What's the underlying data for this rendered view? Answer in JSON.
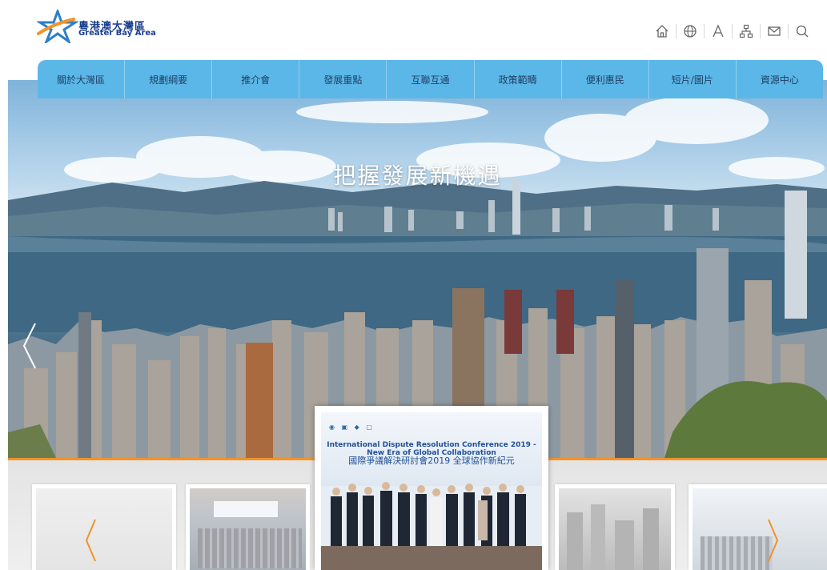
{
  "logo": {
    "name_cn": "粵港澳大灣區",
    "name_en": "Greater Bay Area"
  },
  "toolbar": {
    "icons": [
      "home-icon",
      "globe-icon",
      "font-size-icon",
      "sitemap-icon",
      "mail-icon",
      "search-icon"
    ]
  },
  "nav": {
    "items": [
      {
        "label": "關於大灣區"
      },
      {
        "label": "規劃綱要"
      },
      {
        "label": "推介會"
      },
      {
        "label": "發展重點"
      },
      {
        "label": "互聯互通"
      },
      {
        "label": "政策範疇"
      },
      {
        "label": "便利惠民"
      },
      {
        "label": "短片/圖片"
      },
      {
        "label": "資源中心"
      }
    ]
  },
  "hero": {
    "title": "把握發展新機遇"
  },
  "featured": {
    "banner_en": "International Dispute Resolution Conference 2019 - New Era of Global Collaboration",
    "banner_cn": "國際爭議解決研討會2019 全球協作新紀元"
  },
  "colors": {
    "nav_bg": "#5bb7e8",
    "accent": "#f0932b",
    "logo_text": "#1b3f8f"
  }
}
